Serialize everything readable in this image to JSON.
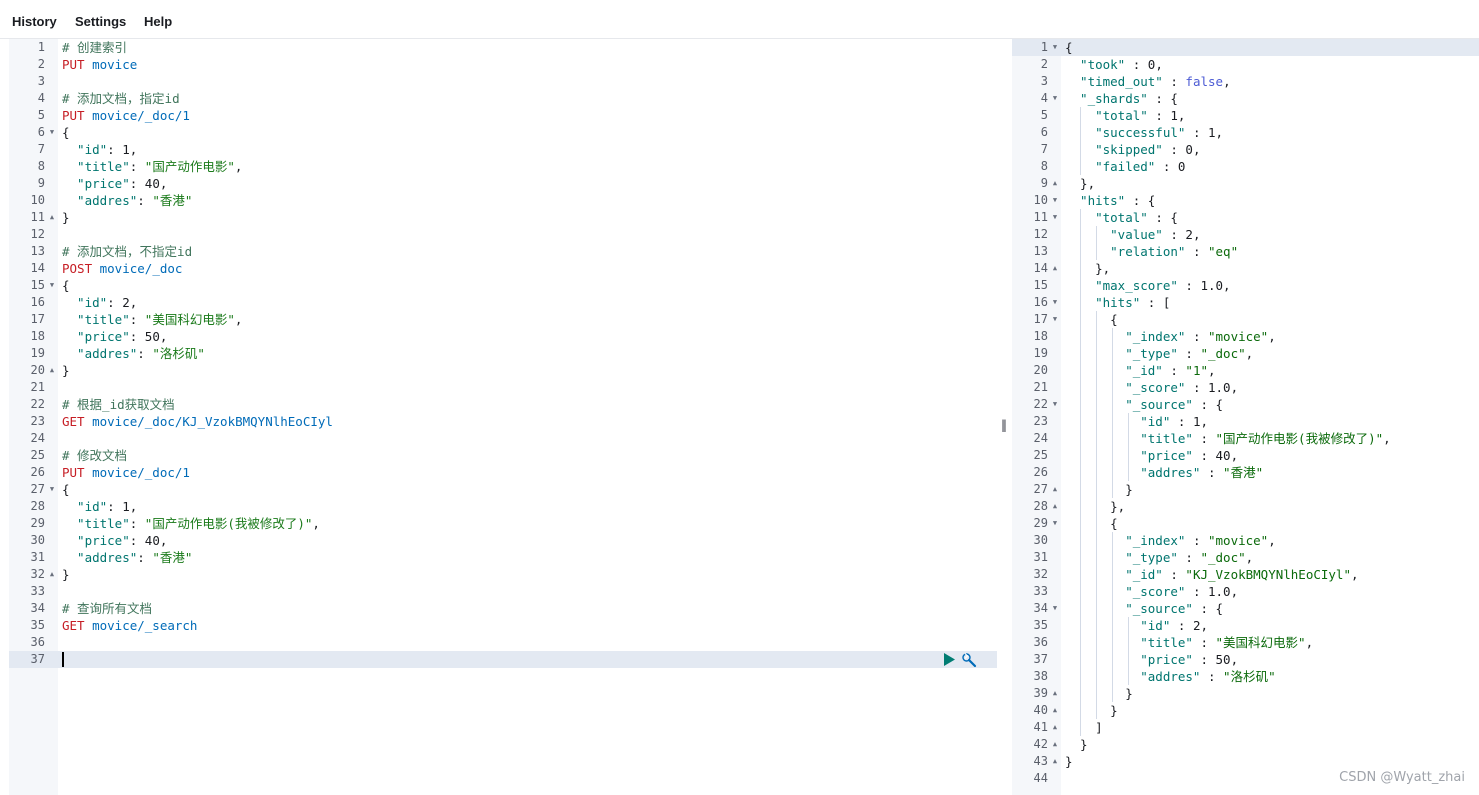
{
  "menu": {
    "history": "History",
    "settings": "Settings",
    "help": "Help"
  },
  "editor": {
    "lines": [
      [
        [
          "t-comment",
          "# 创建索引"
        ]
      ],
      [
        [
          "t-method",
          "PUT"
        ],
        [
          "t-path",
          " movice"
        ]
      ],
      [],
      [
        [
          "t-comment",
          "# 添加文档，指定id"
        ]
      ],
      [
        [
          "t-method",
          "PUT"
        ],
        [
          "t-path",
          " movice/_doc/1"
        ]
      ],
      [
        [
          "t-punc",
          "{"
        ]
      ],
      [
        [
          "t-key",
          "  \"id\""
        ],
        [
          "t-punc",
          ": "
        ],
        [
          "t-num",
          "1"
        ],
        [
          "t-punc",
          ","
        ]
      ],
      [
        [
          "t-key",
          "  \"title\""
        ],
        [
          "t-punc",
          ": "
        ],
        [
          "t-str",
          "\"国产动作电影\""
        ],
        [
          "t-punc",
          ","
        ]
      ],
      [
        [
          "t-key",
          "  \"price\""
        ],
        [
          "t-punc",
          ": "
        ],
        [
          "t-num",
          "40"
        ],
        [
          "t-punc",
          ","
        ]
      ],
      [
        [
          "t-key",
          "  \"addres\""
        ],
        [
          "t-punc",
          ": "
        ],
        [
          "t-str",
          "\"香港\""
        ]
      ],
      [
        [
          "t-punc",
          "}"
        ]
      ],
      [],
      [
        [
          "t-comment",
          "# 添加文档，不指定id"
        ]
      ],
      [
        [
          "t-method",
          "POST"
        ],
        [
          "t-path",
          " movice/_doc"
        ]
      ],
      [
        [
          "t-punc",
          "{"
        ]
      ],
      [
        [
          "t-key",
          "  \"id\""
        ],
        [
          "t-punc",
          ": "
        ],
        [
          "t-num",
          "2"
        ],
        [
          "t-punc",
          ","
        ]
      ],
      [
        [
          "t-key",
          "  \"title\""
        ],
        [
          "t-punc",
          ": "
        ],
        [
          "t-str",
          "\"美国科幻电影\""
        ],
        [
          "t-punc",
          ","
        ]
      ],
      [
        [
          "t-key",
          "  \"price\""
        ],
        [
          "t-punc",
          ": "
        ],
        [
          "t-num",
          "50"
        ],
        [
          "t-punc",
          ","
        ]
      ],
      [
        [
          "t-key",
          "  \"addres\""
        ],
        [
          "t-punc",
          ": "
        ],
        [
          "t-str",
          "\"洛杉矶\""
        ]
      ],
      [
        [
          "t-punc",
          "}"
        ]
      ],
      [],
      [
        [
          "t-comment",
          "# 根据_id获取文档"
        ]
      ],
      [
        [
          "t-method",
          "GET"
        ],
        [
          "t-path",
          " movice/_doc/KJ_VzokBMQYNlhEoCIyl"
        ]
      ],
      [],
      [
        [
          "t-comment",
          "# 修改文档"
        ]
      ],
      [
        [
          "t-method",
          "PUT"
        ],
        [
          "t-path",
          " movice/_doc/1"
        ]
      ],
      [
        [
          "t-punc",
          "{"
        ]
      ],
      [
        [
          "t-key",
          "  \"id\""
        ],
        [
          "t-punc",
          ": "
        ],
        [
          "t-num",
          "1"
        ],
        [
          "t-punc",
          ","
        ]
      ],
      [
        [
          "t-key",
          "  \"title\""
        ],
        [
          "t-punc",
          ": "
        ],
        [
          "t-str",
          "\"国产动作电影(我被修改了)\""
        ],
        [
          "t-punc",
          ","
        ]
      ],
      [
        [
          "t-key",
          "  \"price\""
        ],
        [
          "t-punc",
          ": "
        ],
        [
          "t-num",
          "40"
        ],
        [
          "t-punc",
          ","
        ]
      ],
      [
        [
          "t-key",
          "  \"addres\""
        ],
        [
          "t-punc",
          ": "
        ],
        [
          "t-str",
          "\"香港\""
        ]
      ],
      [
        [
          "t-punc",
          "}"
        ]
      ],
      [],
      [
        [
          "t-comment",
          "# 查询所有文档"
        ]
      ],
      [
        [
          "t-method",
          "GET"
        ],
        [
          "t-path",
          " movice/_search"
        ]
      ],
      [],
      []
    ],
    "folds": {
      "6": "open",
      "11": "close",
      "15": "open",
      "20": "close",
      "27": "open",
      "32": "close"
    },
    "active_line": 37
  },
  "response": {
    "lines": [
      [
        [
          "t-punc",
          "{"
        ]
      ],
      [
        [
          "t-key",
          "  \"took\""
        ],
        [
          "t-punc",
          " : "
        ],
        [
          "t-num",
          "0"
        ],
        [
          "t-punc",
          ","
        ]
      ],
      [
        [
          "t-key",
          "  \"timed_out\""
        ],
        [
          "t-punc",
          " : "
        ],
        [
          "t-bool",
          "false"
        ],
        [
          "t-punc",
          ","
        ]
      ],
      [
        [
          "t-key",
          "  \"_shards\""
        ],
        [
          "t-punc",
          " : {"
        ]
      ],
      [
        [
          "t-key",
          "    \"total\""
        ],
        [
          "t-punc",
          " : "
        ],
        [
          "t-num",
          "1"
        ],
        [
          "t-punc",
          ","
        ]
      ],
      [
        [
          "t-key",
          "    \"successful\""
        ],
        [
          "t-punc",
          " : "
        ],
        [
          "t-num",
          "1"
        ],
        [
          "t-punc",
          ","
        ]
      ],
      [
        [
          "t-key",
          "    \"skipped\""
        ],
        [
          "t-punc",
          " : "
        ],
        [
          "t-num",
          "0"
        ],
        [
          "t-punc",
          ","
        ]
      ],
      [
        [
          "t-key",
          "    \"failed\""
        ],
        [
          "t-punc",
          " : "
        ],
        [
          "t-num",
          "0"
        ]
      ],
      [
        [
          "t-punc",
          "  },"
        ]
      ],
      [
        [
          "t-key",
          "  \"hits\""
        ],
        [
          "t-punc",
          " : {"
        ]
      ],
      [
        [
          "t-key",
          "    \"total\""
        ],
        [
          "t-punc",
          " : {"
        ]
      ],
      [
        [
          "t-key",
          "      \"value\""
        ],
        [
          "t-punc",
          " : "
        ],
        [
          "t-num",
          "2"
        ],
        [
          "t-punc",
          ","
        ]
      ],
      [
        [
          "t-key",
          "      \"relation\""
        ],
        [
          "t-punc",
          " : "
        ],
        [
          "t-str2",
          "\"eq\""
        ]
      ],
      [
        [
          "t-punc",
          "    },"
        ]
      ],
      [
        [
          "t-key",
          "    \"max_score\""
        ],
        [
          "t-punc",
          " : "
        ],
        [
          "t-num",
          "1.0"
        ],
        [
          "t-punc",
          ","
        ]
      ],
      [
        [
          "t-key",
          "    \"hits\""
        ],
        [
          "t-punc",
          " : ["
        ]
      ],
      [
        [
          "t-punc",
          "      {"
        ]
      ],
      [
        [
          "t-key",
          "        \"_index\""
        ],
        [
          "t-punc",
          " : "
        ],
        [
          "t-str2",
          "\"movice\""
        ],
        [
          "t-punc",
          ","
        ]
      ],
      [
        [
          "t-key",
          "        \"_type\""
        ],
        [
          "t-punc",
          " : "
        ],
        [
          "t-str2",
          "\"_doc\""
        ],
        [
          "t-punc",
          ","
        ]
      ],
      [
        [
          "t-key",
          "        \"_id\""
        ],
        [
          "t-punc",
          " : "
        ],
        [
          "t-str2",
          "\"1\""
        ],
        [
          "t-punc",
          ","
        ]
      ],
      [
        [
          "t-key",
          "        \"_score\""
        ],
        [
          "t-punc",
          " : "
        ],
        [
          "t-num",
          "1.0"
        ],
        [
          "t-punc",
          ","
        ]
      ],
      [
        [
          "t-key",
          "        \"_source\""
        ],
        [
          "t-punc",
          " : {"
        ]
      ],
      [
        [
          "t-key",
          "          \"id\""
        ],
        [
          "t-punc",
          " : "
        ],
        [
          "t-num",
          "1"
        ],
        [
          "t-punc",
          ","
        ]
      ],
      [
        [
          "t-key",
          "          \"title\""
        ],
        [
          "t-punc",
          " : "
        ],
        [
          "t-str2",
          "\"国产动作电影(我被修改了)\""
        ],
        [
          "t-punc",
          ","
        ]
      ],
      [
        [
          "t-key",
          "          \"price\""
        ],
        [
          "t-punc",
          " : "
        ],
        [
          "t-num",
          "40"
        ],
        [
          "t-punc",
          ","
        ]
      ],
      [
        [
          "t-key",
          "          \"addres\""
        ],
        [
          "t-punc",
          " : "
        ],
        [
          "t-str2",
          "\"香港\""
        ]
      ],
      [
        [
          "t-punc",
          "        }"
        ]
      ],
      [
        [
          "t-punc",
          "      },"
        ]
      ],
      [
        [
          "t-punc",
          "      {"
        ]
      ],
      [
        [
          "t-key",
          "        \"_index\""
        ],
        [
          "t-punc",
          " : "
        ],
        [
          "t-str2",
          "\"movice\""
        ],
        [
          "t-punc",
          ","
        ]
      ],
      [
        [
          "t-key",
          "        \"_type\""
        ],
        [
          "t-punc",
          " : "
        ],
        [
          "t-str2",
          "\"_doc\""
        ],
        [
          "t-punc",
          ","
        ]
      ],
      [
        [
          "t-key",
          "        \"_id\""
        ],
        [
          "t-punc",
          " : "
        ],
        [
          "t-str2",
          "\"KJ_VzokBMQYNlhEoCIyl\""
        ],
        [
          "t-punc",
          ","
        ]
      ],
      [
        [
          "t-key",
          "        \"_score\""
        ],
        [
          "t-punc",
          " : "
        ],
        [
          "t-num",
          "1.0"
        ],
        [
          "t-punc",
          ","
        ]
      ],
      [
        [
          "t-key",
          "        \"_source\""
        ],
        [
          "t-punc",
          " : {"
        ]
      ],
      [
        [
          "t-key",
          "          \"id\""
        ],
        [
          "t-punc",
          " : "
        ],
        [
          "t-num",
          "2"
        ],
        [
          "t-punc",
          ","
        ]
      ],
      [
        [
          "t-key",
          "          \"title\""
        ],
        [
          "t-punc",
          " : "
        ],
        [
          "t-str2",
          "\"美国科幻电影\""
        ],
        [
          "t-punc",
          ","
        ]
      ],
      [
        [
          "t-key",
          "          \"price\""
        ],
        [
          "t-punc",
          " : "
        ],
        [
          "t-num",
          "50"
        ],
        [
          "t-punc",
          ","
        ]
      ],
      [
        [
          "t-key",
          "          \"addres\""
        ],
        [
          "t-punc",
          " : "
        ],
        [
          "t-str2",
          "\"洛杉矶\""
        ]
      ],
      [
        [
          "t-punc",
          "        }"
        ]
      ],
      [
        [
          "t-punc",
          "      }"
        ]
      ],
      [
        [
          "t-punc",
          "    ]"
        ]
      ],
      [
        [
          "t-punc",
          "  }"
        ]
      ],
      [
        [
          "t-punc",
          "}"
        ]
      ],
      []
    ],
    "folds": {
      "1": "open",
      "4": "open",
      "9": "close",
      "10": "open",
      "11": "open",
      "14": "close",
      "16": "open",
      "17": "open",
      "22": "open",
      "27": "close",
      "28": "close",
      "29": "open",
      "34": "open",
      "39": "close",
      "40": "close",
      "41": "close",
      "42": "close",
      "43": "close"
    },
    "active_line": 1
  },
  "divider_grip": "‖",
  "watermark": "CSDN @Wyatt_zhai"
}
